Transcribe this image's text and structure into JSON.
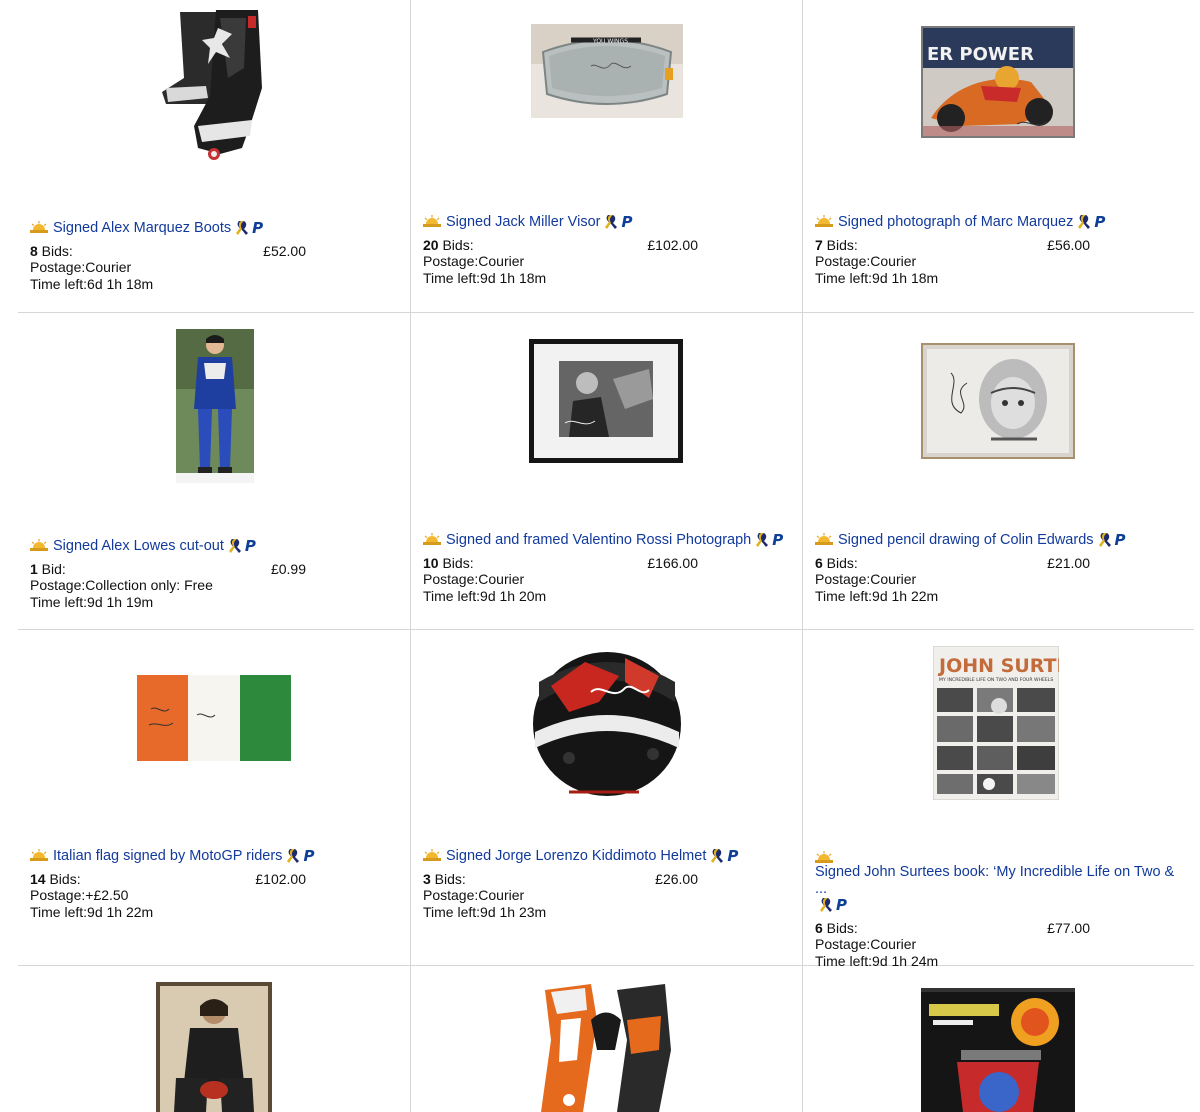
{
  "colors": {
    "link": "#123a9c",
    "divider": "#d6d6d6",
    "paypal": "#0e3f96"
  },
  "icons": {
    "seller": "sun-seller-icon",
    "charity": "ribbon-icon",
    "payment": "paypal-icon"
  },
  "listings": [
    {
      "title": "Signed Alex Marquez Boots",
      "bids_count": "8",
      "bids_label": " Bids:",
      "price": "£52.00",
      "postage": "Postage:Courier",
      "time_left": "Time left:6d 1h 18m"
    },
    {
      "title": "Signed Jack Miller Visor",
      "bids_count": "20",
      "bids_label": " Bids:",
      "price": "£102.00",
      "postage": "Postage:Courier",
      "time_left": "Time left:9d 1h 18m"
    },
    {
      "title": "Signed photograph of Marc Marquez",
      "bids_count": "7",
      "bids_label": " Bids:",
      "price": "£56.00",
      "postage": "Postage:Courier",
      "time_left": "Time left:9d 1h 18m"
    },
    {
      "title": "Signed Alex Lowes cut-out",
      "bids_count": "1",
      "bids_label": " Bid:",
      "price": "£0.99",
      "postage": "Postage:Collection only: Free",
      "time_left": "Time left:9d 1h 19m"
    },
    {
      "title": "Signed and framed Valentino Rossi Photograph",
      "bids_count": "10",
      "bids_label": " Bids:",
      "price": "£166.00",
      "postage": "Postage:Courier",
      "time_left": "Time left:9d 1h 20m"
    },
    {
      "title": "Signed pencil drawing of Colin Edwards",
      "bids_count": "6",
      "bids_label": " Bids:",
      "price": "£21.00",
      "postage": "Postage:Courier",
      "time_left": "Time left:9d 1h 22m"
    },
    {
      "title": "Italian flag signed by MotoGP riders",
      "bids_count": "14",
      "bids_label": " Bids:",
      "price": "£102.00",
      "postage": "Postage:+£2.50",
      "time_left": "Time left:9d 1h 22m"
    },
    {
      "title": "Signed Jorge Lorenzo Kiddimoto Helmet",
      "bids_count": "3",
      "bids_label": " Bids:",
      "price": "£26.00",
      "postage": "Postage:Courier",
      "time_left": "Time left:9d 1h 23m"
    },
    {
      "title": "Signed John Surtees book: ‘My Incredible Life on Two & ...",
      "bids_count": "6",
      "bids_label": " Bids:",
      "price": "£77.00",
      "postage": "Postage:Courier",
      "time_left": "Time left:9d 1h 24m"
    }
  ],
  "images": {
    "poster_banner": "ER POWER",
    "book_title": "JOHN SURTEES",
    "book_subtitle": "MY INCREDIBLE LIFE ON TWO AND FOUR WHEELS",
    "visor_text": "YOU WINGS"
  }
}
